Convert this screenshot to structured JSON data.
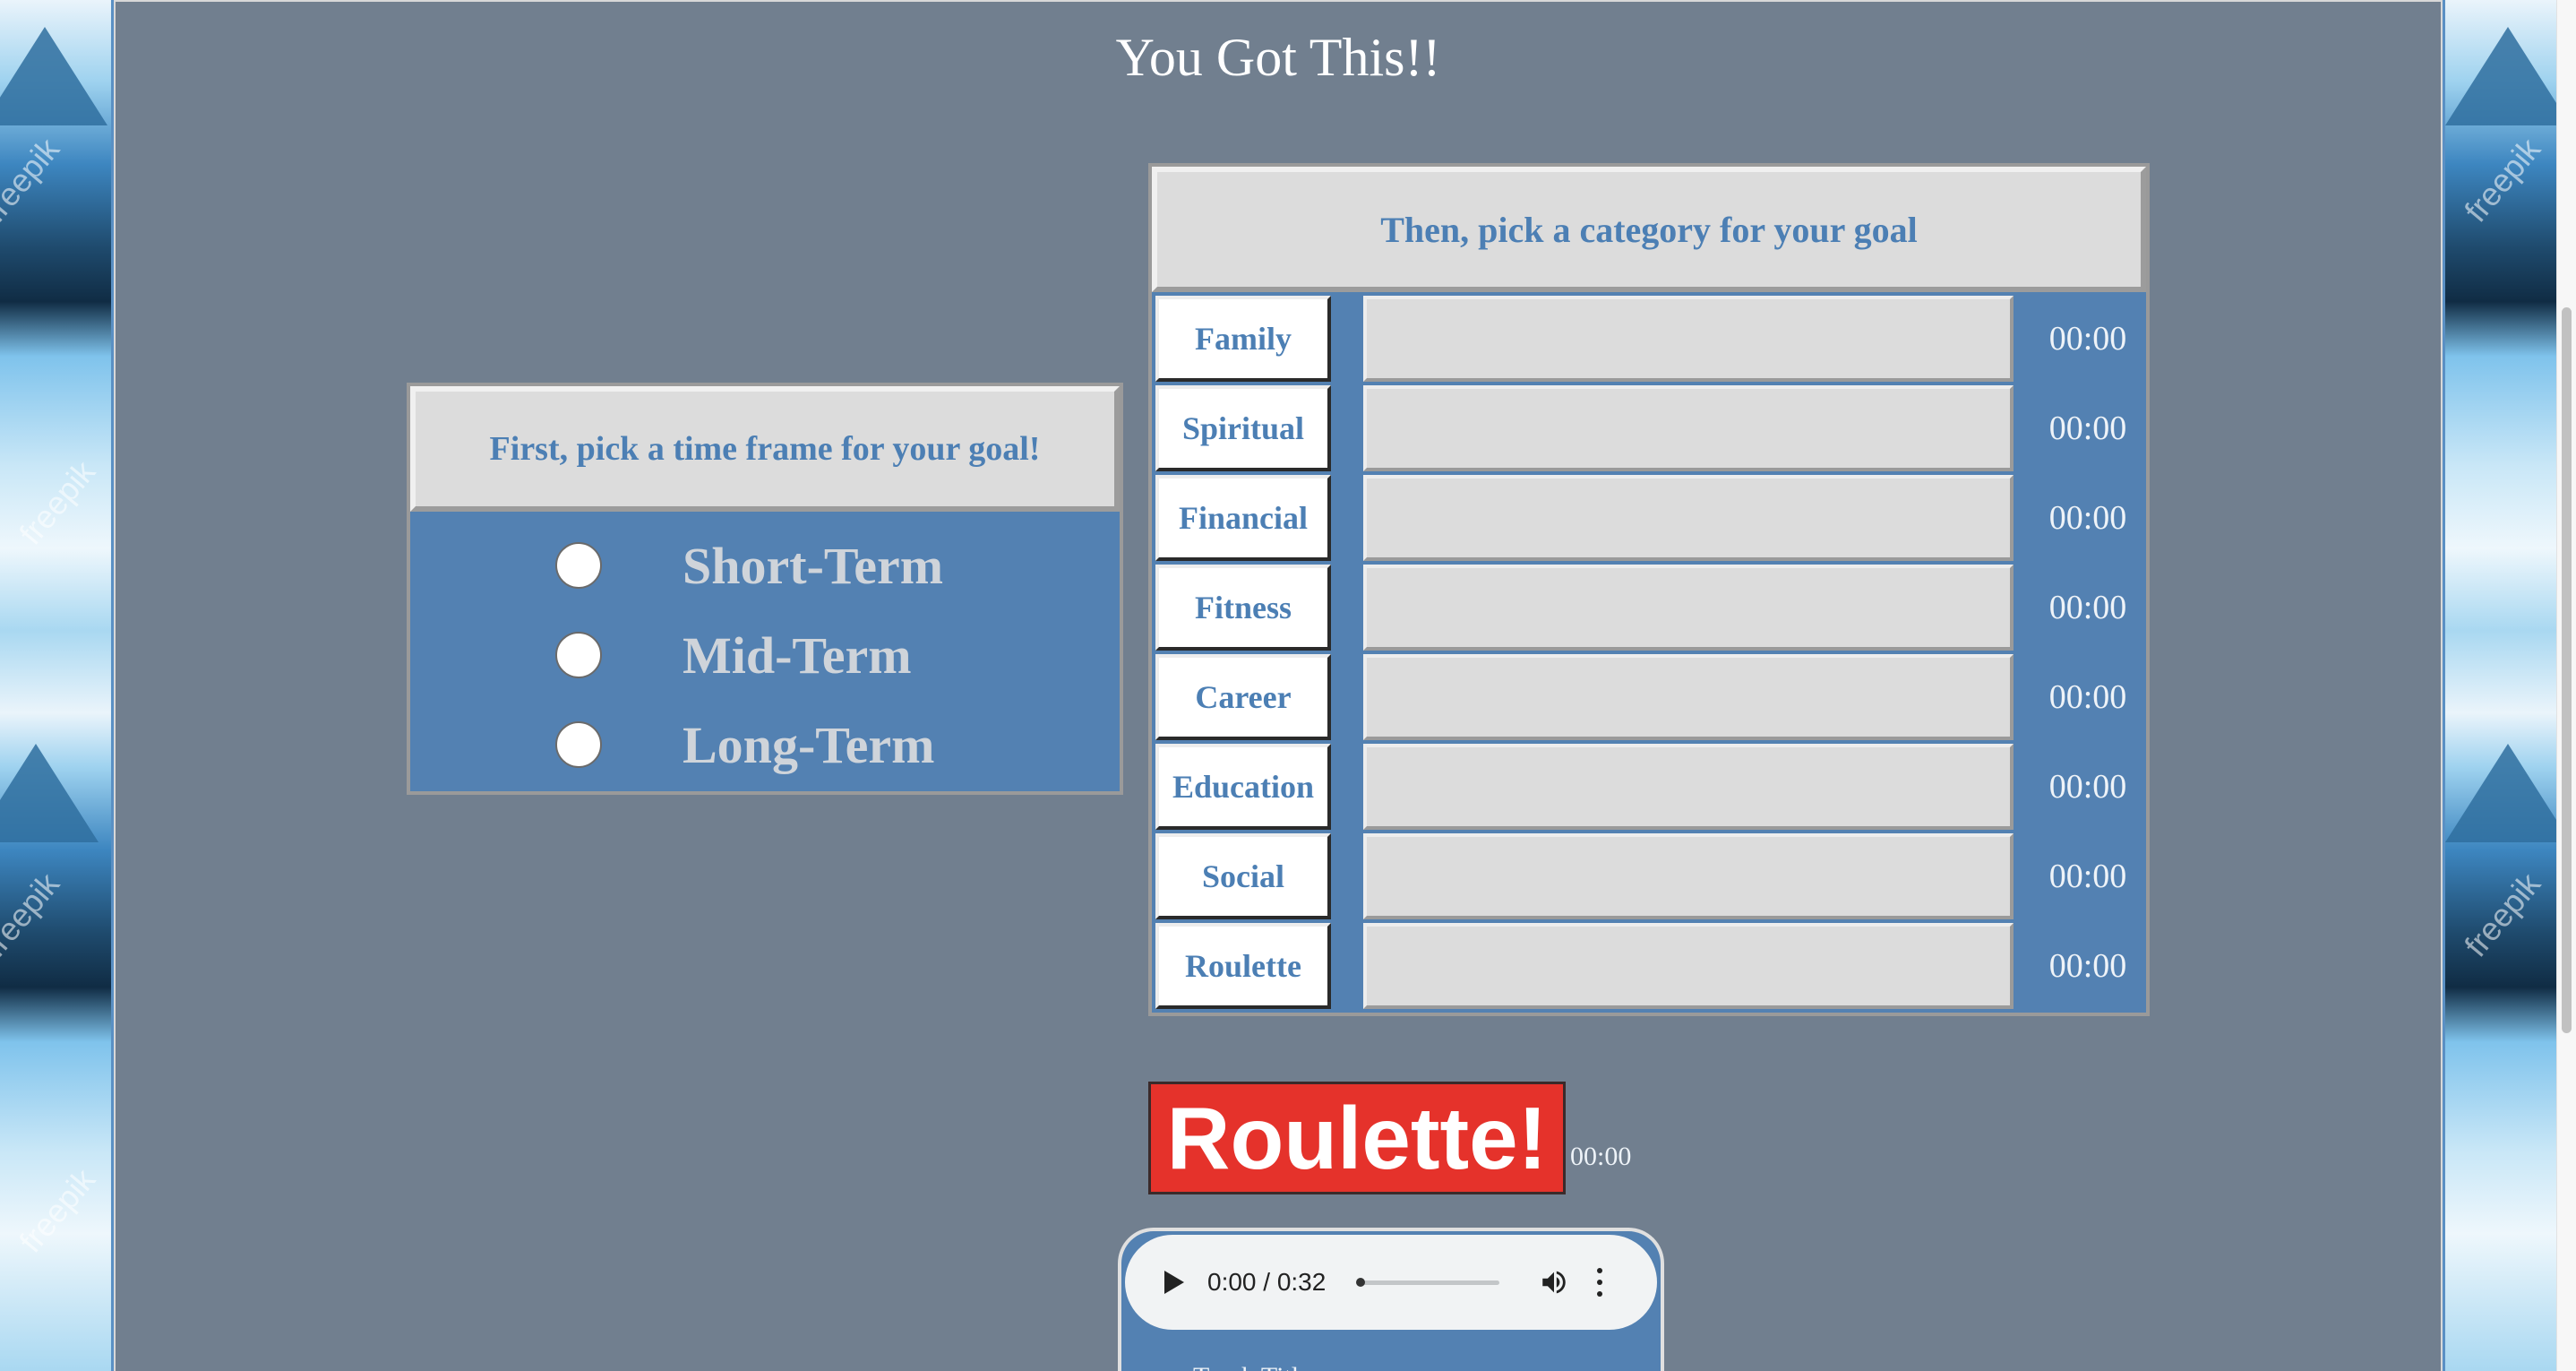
{
  "page": {
    "title": "You Got This!!"
  },
  "time_frame": {
    "header": "First, pick a time frame for your goal!",
    "options": [
      {
        "label": "Short-Term"
      },
      {
        "label": "Mid-Term"
      },
      {
        "label": "Long-Term"
      }
    ]
  },
  "categories": {
    "header": "Then, pick a category for your goal",
    "items": [
      {
        "label": "Family",
        "time": "00:00",
        "value": ""
      },
      {
        "label": "Spiritual",
        "time": "00:00",
        "value": ""
      },
      {
        "label": "Financial",
        "time": "00:00",
        "value": ""
      },
      {
        "label": "Fitness",
        "time": "00:00",
        "value": ""
      },
      {
        "label": "Career",
        "time": "00:00",
        "value": ""
      },
      {
        "label": "Education",
        "time": "00:00",
        "value": ""
      },
      {
        "label": "Social",
        "time": "00:00",
        "value": ""
      },
      {
        "label": "Roulette",
        "time": "00:00",
        "value": ""
      }
    ]
  },
  "roulette": {
    "button_label": "Roulette!",
    "time": "00:00"
  },
  "audio": {
    "time_display": "0:00 / 0:32",
    "progress": 0,
    "caption": "Track Title"
  },
  "colors": {
    "panel_bg": "#717f8f",
    "accent_blue": "#5381b2",
    "label_blue": "#4c7fb4",
    "roulette_red": "#e5322b"
  },
  "watermark": "freepik"
}
